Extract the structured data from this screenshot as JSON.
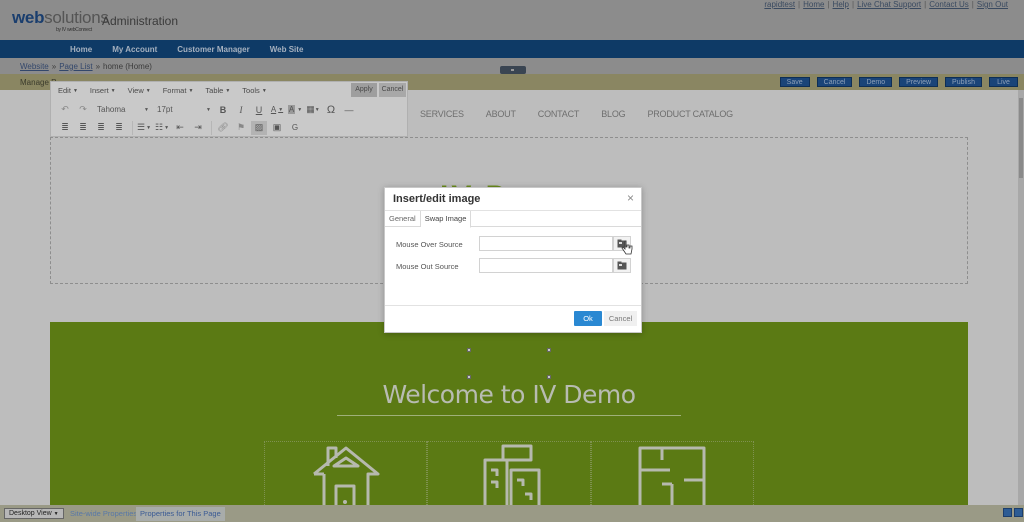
{
  "header": {
    "logo_web": "web",
    "logo_solutions": "solutions",
    "logo_sub": "by IV webConnect",
    "admin_title": "Administration",
    "top_links": [
      "rapidtest",
      "Home",
      "Help",
      "Live Chat Support",
      "Contact Us",
      "Sign Out"
    ]
  },
  "nav": {
    "items": [
      "Home",
      "My Account",
      "Customer Manager",
      "Web Site"
    ]
  },
  "breadcrumb": {
    "items": [
      "Website",
      "Page List"
    ],
    "current": "home (Home)",
    "separator": "»"
  },
  "actionbar": {
    "manage_label": "Manage P",
    "buttons": [
      "Save",
      "Cancel",
      "Demo",
      "Preview",
      "Publish",
      "Live"
    ]
  },
  "editor": {
    "menus": [
      "Edit",
      "Insert",
      "View",
      "Format",
      "Table",
      "Tools"
    ],
    "apply_label": "Apply",
    "cancel_label": "Cancel",
    "font_family": "Tahoma",
    "font_size": "17pt",
    "toolbar_row1": [
      "undo",
      "redo",
      "bold",
      "italic",
      "underline",
      "text-color",
      "background-color",
      "table",
      "special-character",
      "horizontal-rule"
    ],
    "toolbar_row2": [
      "align-left",
      "align-center",
      "align-right",
      "justify",
      "bullet-list",
      "numbered-list",
      "outdent",
      "indent",
      "link",
      "bookmark",
      "image",
      "media",
      "google"
    ]
  },
  "site": {
    "nav": [
      "SERVICES",
      "ABOUT",
      "CONTACT",
      "BLOG",
      "PRODUCT CATALOG"
    ],
    "logo_partial": "IV D",
    "hero_title": "Welcome to IV Demo",
    "feature_icons": [
      "house-icon",
      "buildings-icon",
      "floorplan-icon"
    ]
  },
  "modal": {
    "title": "Insert/edit image",
    "close_glyph": "×",
    "tabs": [
      "General",
      "Swap Image"
    ],
    "active_tab": "Swap Image",
    "fields": [
      {
        "label": "Mouse Over Source",
        "value": ""
      },
      {
        "label": "Mouse Out Source",
        "value": ""
      }
    ],
    "ok_label": "Ok",
    "cancel_label": "Cancel"
  },
  "footer": {
    "view_select": "Desktop View",
    "tabs": [
      "Site-wide Properties",
      "Properties for This Page"
    ],
    "active_tab": "Properties for This Page"
  },
  "colors": {
    "brand_blue": "#0e3a66",
    "hero_green": "#5b7a14",
    "ok_blue": "#2a88d2"
  }
}
